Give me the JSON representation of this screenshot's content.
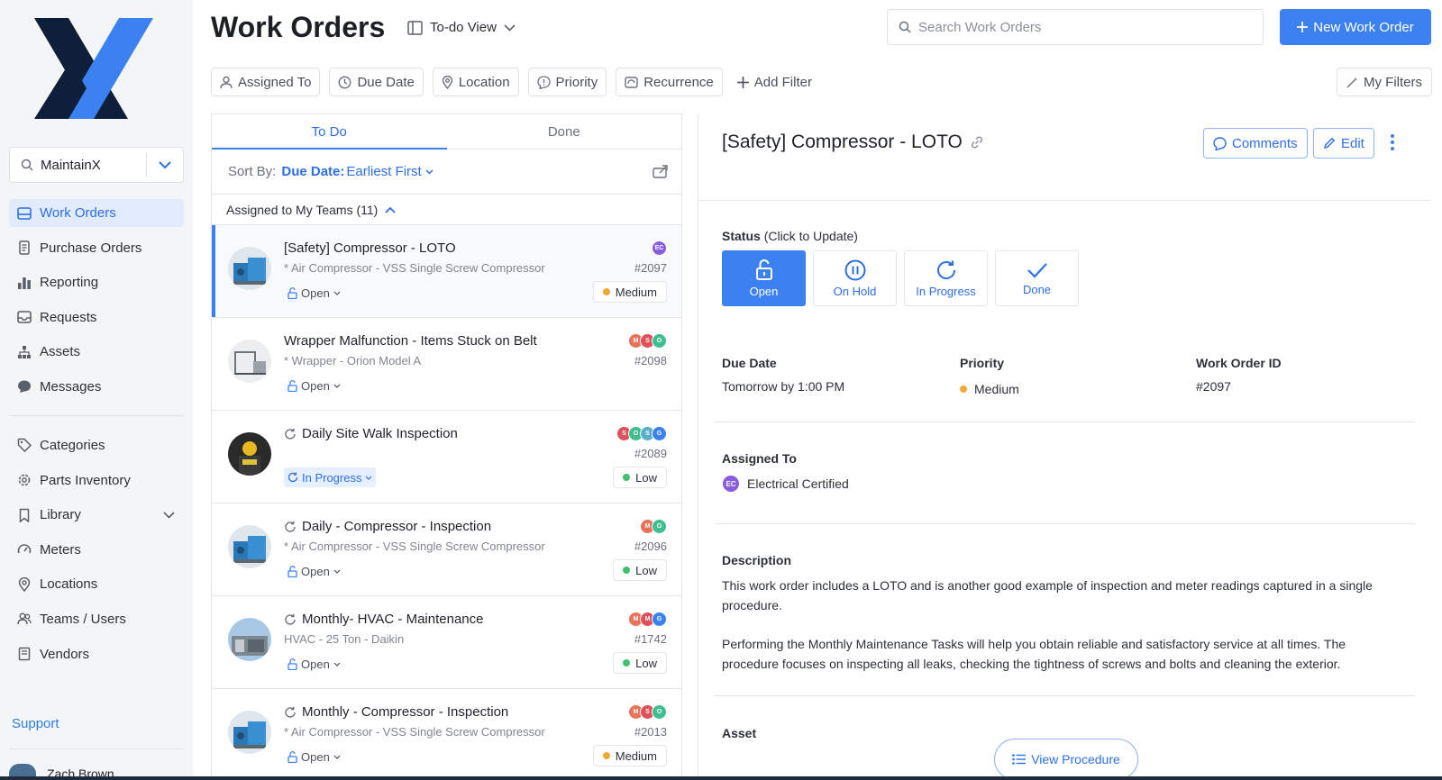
{
  "colors": {
    "accent": "#3b82f0",
    "open_status": "#3b82f0",
    "priority_medium": "#f0a932",
    "priority_low": "#3fbf6f"
  },
  "sidebar": {
    "org_name": "MaintainX",
    "nav_primary": [
      {
        "label": "Work Orders",
        "icon": "work-orders-icon",
        "active": true
      },
      {
        "label": "Purchase Orders",
        "icon": "document-icon"
      },
      {
        "label": "Reporting",
        "icon": "bar-chart-icon"
      },
      {
        "label": "Requests",
        "icon": "inbox-icon"
      },
      {
        "label": "Assets",
        "icon": "hierarchy-icon"
      },
      {
        "label": "Messages",
        "icon": "chat-icon"
      }
    ],
    "nav_secondary": [
      {
        "label": "Categories",
        "icon": "tag-icon"
      },
      {
        "label": "Parts Inventory",
        "icon": "gear-icon"
      },
      {
        "label": "Library",
        "icon": "bookmark-icon"
      },
      {
        "label": "Meters",
        "icon": "gauge-icon"
      },
      {
        "label": "Locations",
        "icon": "location-pin-icon"
      },
      {
        "label": "Teams / Users",
        "icon": "users-icon"
      },
      {
        "label": "Vendors",
        "icon": "vendor-icon"
      }
    ],
    "support": "Support",
    "user_name": "Zach Brown"
  },
  "header": {
    "title": "Work Orders",
    "view_label": "To-do View",
    "search_placeholder": "Search Work Orders",
    "new_button": "New Work Order",
    "filters": [
      "Assigned To",
      "Due Date",
      "Location",
      "Priority",
      "Recurrence"
    ],
    "add_filter": "Add Filter",
    "my_filters": "My Filters"
  },
  "list": {
    "tabs": [
      "To Do",
      "Done"
    ],
    "sort_prefix": "Sort By:",
    "sort_field": "Due Date:",
    "sort_order": "Earliest First",
    "group_label": "Assigned to My Teams (11)",
    "items": [
      {
        "title": "[Safety] Compressor - LOTO",
        "asset": "* Air Compressor - VSS Single Screw Compressor",
        "status": "Open",
        "id": "#2097",
        "priority": "Medium",
        "avatars": [
          "EC"
        ],
        "recurring": false
      },
      {
        "title": "Wrapper Malfunction - Items Stuck on Belt",
        "asset": "* Wrapper - Orion Model A",
        "status": "Open",
        "id": "#2098",
        "priority": "",
        "avatars": [
          "M",
          "S",
          "O"
        ],
        "recurring": false
      },
      {
        "title": "Daily Site Walk Inspection",
        "asset": "",
        "status": "In Progress",
        "id": "#2089",
        "priority": "Low",
        "avatars": [
          "S",
          "O",
          "S",
          "G"
        ],
        "recurring": true
      },
      {
        "title": "Daily - Compressor - Inspection",
        "asset": "* Air Compressor - VSS Single Screw Compressor",
        "status": "Open",
        "id": "#2096",
        "priority": "Low",
        "avatars": [
          "M",
          "O"
        ],
        "recurring": true
      },
      {
        "title": "Monthly- HVAC - Maintenance",
        "asset": "HVAC - 25 Ton - Daikin",
        "status": "Open",
        "id": "#1742",
        "priority": "Low",
        "avatars": [
          "M",
          "M",
          "G"
        ],
        "recurring": true
      },
      {
        "title": "Monthly - Compressor - Inspection",
        "asset": "* Air Compressor - VSS Single Screw Compressor",
        "status": "Open",
        "id": "#2013",
        "priority": "Medium",
        "avatars": [
          "M",
          "S",
          "O"
        ],
        "recurring": true
      }
    ]
  },
  "detail": {
    "title": "[Safety] Compressor - LOTO",
    "comments": "Comments",
    "edit": "Edit",
    "status_label": "Status",
    "status_hint": "(Click to Update)",
    "statuses": [
      "Open",
      "On Hold",
      "In Progress",
      "Done"
    ],
    "due_date_label": "Due Date",
    "due_date": "Tomorrow by 1:00 PM",
    "priority_label": "Priority",
    "priority": "Medium",
    "wo_id_label": "Work Order ID",
    "wo_id": "#2097",
    "assigned_label": "Assigned To",
    "assigned_team": "Electrical Certified",
    "assigned_avatar": "EC",
    "description_label": "Description",
    "description_1": "This work order includes a LOTO and is another good example of inspection and meter readings captured in a single procedure.",
    "description_2": "Performing the Monthly Maintenance Tasks will help you obtain reliable and satisfactory service at all times. The procedure focuses on inspecting all leaks, checking the tightness of screws and bolts and cleaning the exterior.",
    "asset_label": "Asset",
    "view_procedure": "View Procedure"
  }
}
